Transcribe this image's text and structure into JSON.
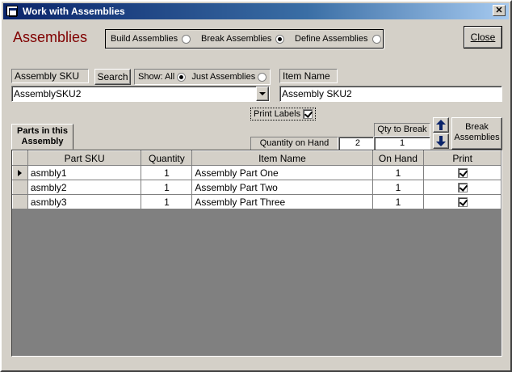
{
  "window": {
    "title": "Work with Assemblies",
    "close_glyph": "✕"
  },
  "form": {
    "title": "Assemblies"
  },
  "mode": {
    "options": [
      {
        "label": "Build Assemblies",
        "selected": false
      },
      {
        "label": "Break Assemblies",
        "selected": true
      },
      {
        "label": "Define Assemblies",
        "selected": false
      }
    ]
  },
  "close_button": {
    "label": "Close"
  },
  "assembly_sku": {
    "label": "Assembly SKU",
    "value": "AssemblySKU2"
  },
  "search_button": {
    "label": "Search"
  },
  "show_filter": {
    "label": "Show: All",
    "just_label": "Just Assemblies",
    "all_selected": true,
    "just_selected": false
  },
  "item_name": {
    "label": "Item Name",
    "value": "Assembly SKU2"
  },
  "print_labels": {
    "label": "Print Labels",
    "checked": true
  },
  "qty_on_hand": {
    "label": "Quantity on Hand",
    "value": "2"
  },
  "qty_to_break": {
    "label": "Qty to Break",
    "value": "1"
  },
  "break_button": {
    "label_line1": "Break",
    "label_line2": "Assemblies"
  },
  "parts_tab": {
    "label_line1": "Parts in this",
    "label_line2": "Assembly"
  },
  "table": {
    "columns": [
      "Part SKU",
      "Quantity",
      "Item Name",
      "On Hand",
      "Print"
    ],
    "rows": [
      {
        "sku": "asmbly1",
        "qty": "1",
        "name": "Assembly Part One",
        "on_hand": "1",
        "print": true,
        "current": true
      },
      {
        "sku": "asmbly2",
        "qty": "1",
        "name": "Assembly Part Two",
        "on_hand": "1",
        "print": true,
        "current": false
      },
      {
        "sku": "asmbly3",
        "qty": "1",
        "name": "Assembly Part Three",
        "on_hand": "1",
        "print": true,
        "current": false
      }
    ]
  },
  "colors": {
    "form_title": "#800000",
    "titlebar": "#0a246a",
    "arrow": "#0a246a"
  }
}
